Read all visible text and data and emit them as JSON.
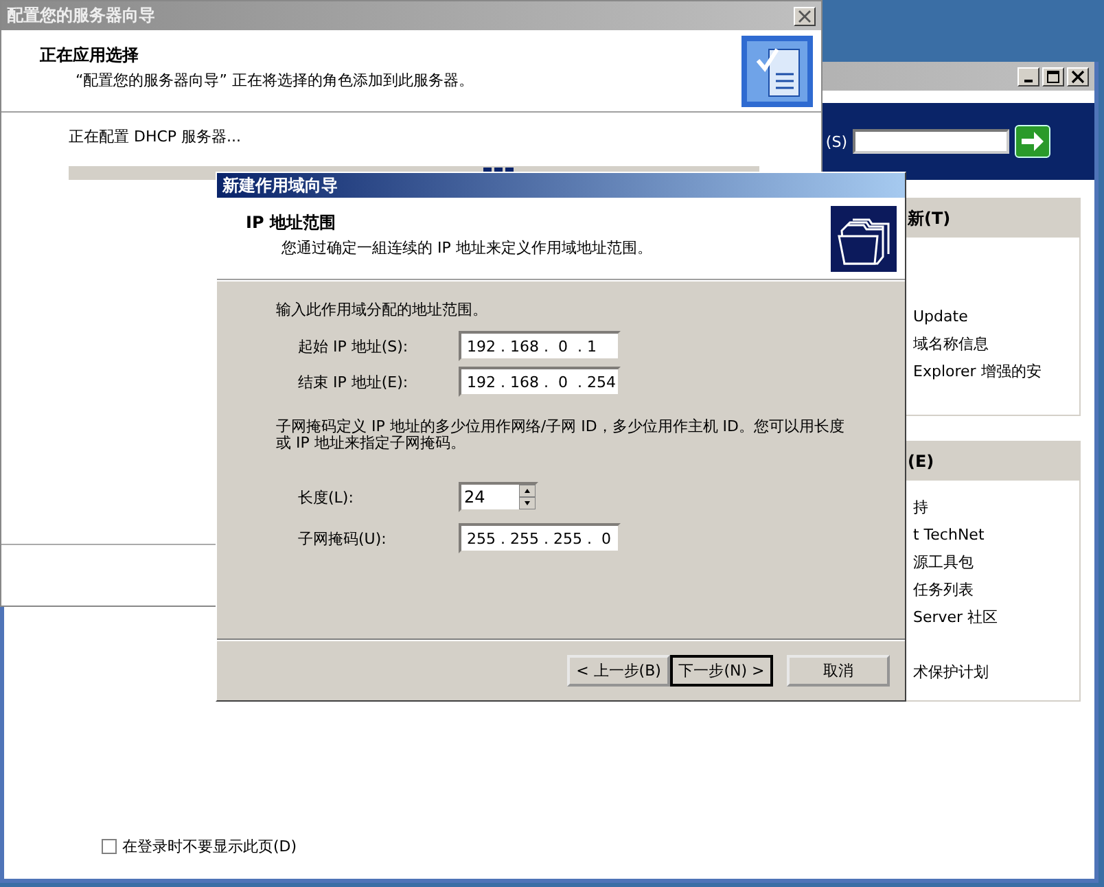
{
  "back_window": {
    "search_label": "(S)",
    "panels": [
      {
        "header": "新(T)",
        "groups": [
          [
            "Update",
            "域名称信息",
            "Explorer 增强的安"
          ]
        ]
      },
      {
        "header": "(E)",
        "groups": [
          [
            "持",
            "t TechNet",
            "源工具包",
            "任务列表",
            "Server 社区"
          ],
          [
            "术保护计划"
          ]
        ]
      }
    ],
    "checkbox": {
      "label": "在登录时不要显示此页(D)",
      "checked": false
    }
  },
  "server_wizard": {
    "title": "配置您的服务器向导",
    "heading": "正在应用选择",
    "subheading": "“配置您的服务器向导” 正在将选择的角色添加到此服务器。",
    "status": "正在配置 DHCP 服务器...",
    "progress": {
      "level": 0.6
    }
  },
  "scope_wizard": {
    "title": "新建作用域向导",
    "heading": "IP 地址范围",
    "subheading": "您通过确定一組连续的 IP 地址来定义作用域地址范围。",
    "intro": "输入此作用域分配的地址范围。",
    "range_fields": [
      {
        "label": "起始 IP 地址(S):",
        "value": "192 . 168 .  0  . 1"
      },
      {
        "label": "结束 IP 地址(E):",
        "value": "192 . 168 .  0  . 254"
      }
    ],
    "explanation": "子网掩码定义 IP 地址的多少位用作网络/子网 ID，多少位用作主机 ID。您可以用长度或 IP 地址来指定子网掩码。",
    "length": {
      "label": "长度(L):",
      "value": "24"
    },
    "mask": {
      "label": "子网掩码(U):",
      "value": "255 . 255 . 255 .  0"
    },
    "buttons": [
      {
        "label": "< 上一步(B)",
        "default": false
      },
      {
        "label": "下一步(N) >",
        "default": true
      },
      {
        "label": "取消",
        "default": false
      }
    ]
  }
}
